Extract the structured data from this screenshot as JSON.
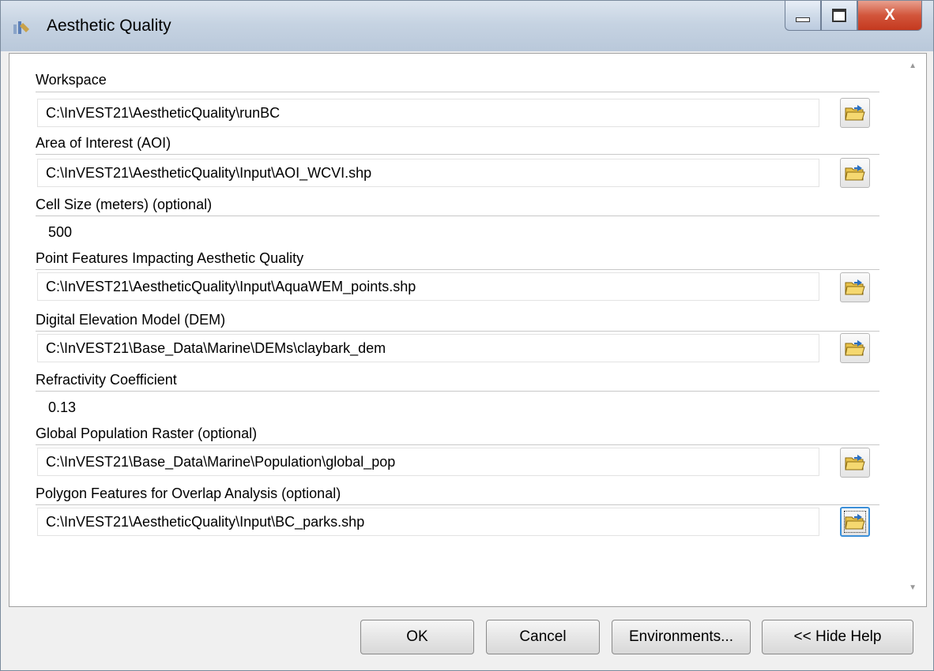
{
  "window": {
    "title": "Aesthetic Quality",
    "close_glyph": "X",
    "icon": "arcgis-tool-icon"
  },
  "params": [
    {
      "label": "Workspace",
      "value": "C:\\InVEST21\\AestheticQuality\\runBC",
      "browse": true
    },
    {
      "label": "Area of Interest (AOI)",
      "value": "C:\\InVEST21\\AestheticQuality\\Input\\AOI_WCVI.shp",
      "browse": true
    },
    {
      "label": "Cell Size (meters) (optional)",
      "value": "500",
      "browse": false
    },
    {
      "label": "Point Features Impacting Aesthetic Quality",
      "value": "C:\\InVEST21\\AestheticQuality\\Input\\AquaWEM_points.shp",
      "browse": true
    },
    {
      "label": "Digital Elevation Model (DEM)",
      "value": "C:\\InVEST21\\Base_Data\\Marine\\DEMs\\claybark_dem",
      "browse": true
    },
    {
      "label": "Refractivity Coefficient",
      "value": "0.13",
      "browse": false
    },
    {
      "label": "Global Population Raster (optional)",
      "value": "C:\\InVEST21\\Base_Data\\Marine\\Population\\global_pop",
      "browse": true
    },
    {
      "label": "Polygon Features for Overlap Analysis (optional)",
      "value": "C:\\InVEST21\\AestheticQuality\\Input\\BC_parks.shp",
      "browse": true
    }
  ],
  "buttons": {
    "ok": "OK",
    "cancel": "Cancel",
    "environments": "Environments...",
    "hide_help": "<< Hide Help"
  },
  "colors": {
    "folder": "#e8c24a",
    "arrow": "#2a6fc0",
    "focus": "#3b8fd8"
  }
}
